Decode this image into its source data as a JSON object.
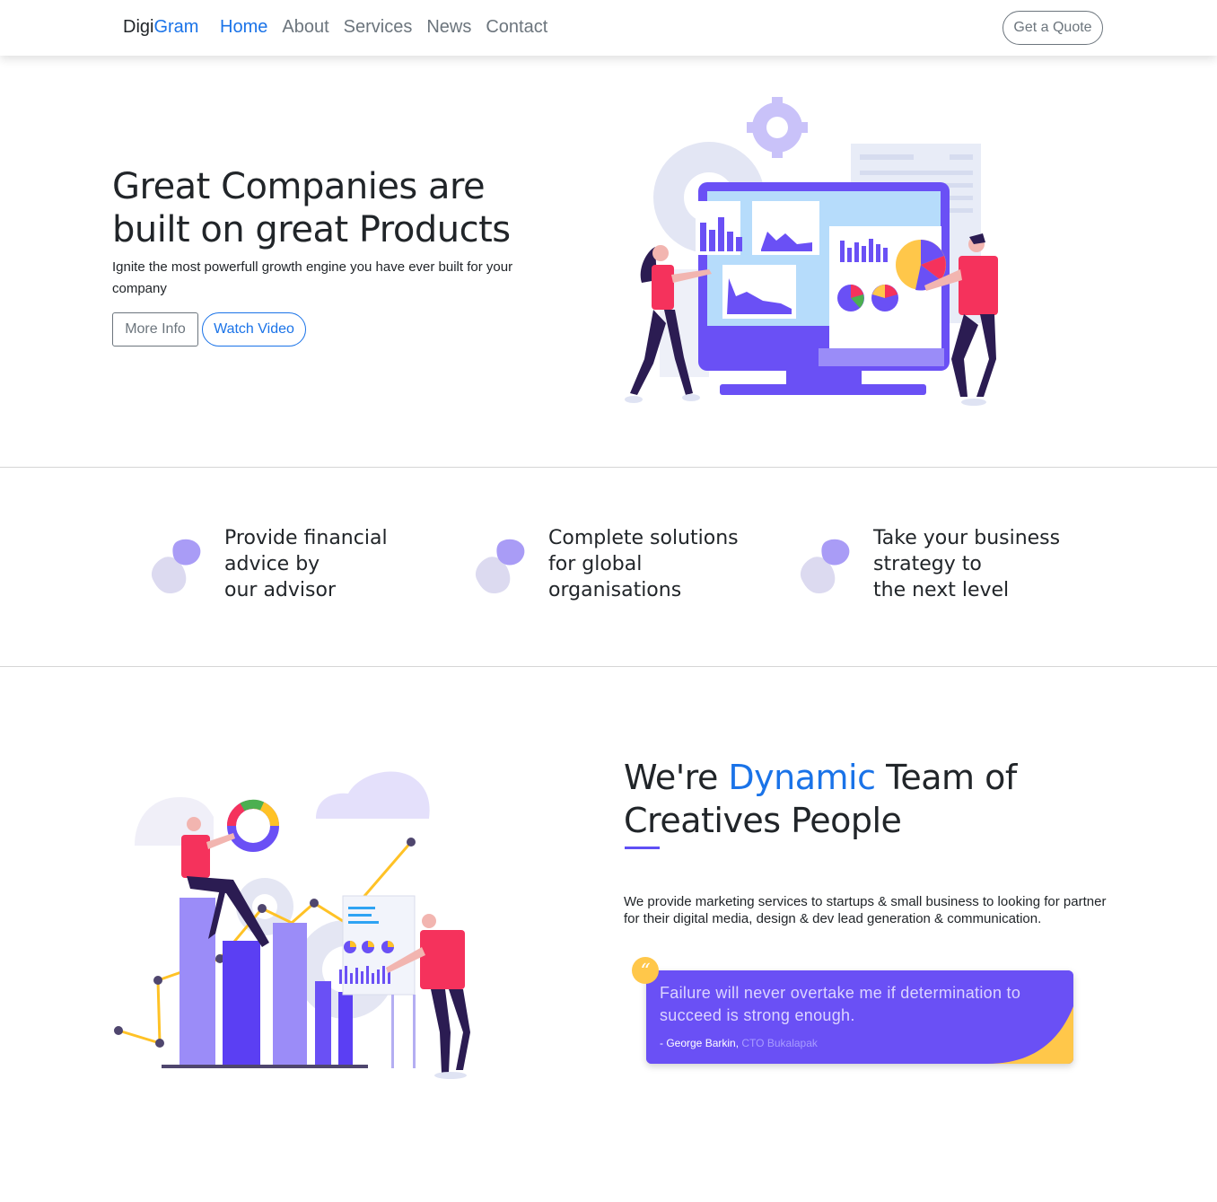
{
  "navbar": {
    "brand_part1": "Digi",
    "brand_part2": "Gram",
    "links": [
      {
        "label": "Home",
        "active": true
      },
      {
        "label": "About",
        "active": false
      },
      {
        "label": "Services",
        "active": false
      },
      {
        "label": "News",
        "active": false
      },
      {
        "label": "Contact",
        "active": false
      }
    ],
    "cta_label": "Get a Quote"
  },
  "hero": {
    "title_line1": "Great Companies are",
    "title_line2": "built on great Products",
    "subtitle": "Ignite the most powerfull growth engine you have ever built for your company",
    "more_info_label": "More Info",
    "watch_video_label": "Watch Video",
    "illustration": "analytics-dashboard-illustration"
  },
  "features": [
    {
      "line1": "Provide financial",
      "line2": "advice by",
      "line3": "our advisor",
      "icon": "blob-icon"
    },
    {
      "line1": "Complete solutions",
      "line2": "for global",
      "line3": "organisations",
      "icon": "blob-icon"
    },
    {
      "line1": "Take your business",
      "line2": "strategy to",
      "line3": "the next level",
      "icon": "blob-icon"
    }
  ],
  "team": {
    "title_part1": "We're ",
    "title_accent": "Dynamic",
    "title_part2": " Team of",
    "title_line2": "Creatives People",
    "description": "We provide marketing services to startups & small business to looking for partner for their digital media, design & dev lead generation & communication.",
    "illustration": "team-growth-chart-illustration",
    "quote": {
      "mark": "“",
      "text": "Failure will never overtake me if determination to succeed is strong enough.",
      "author": "- George Barkin,",
      "role": "CTO Bukalapak"
    }
  },
  "colors": {
    "accent_blue": "#1a73e8",
    "purple": "#6a50f5",
    "yellow": "#ffc74a",
    "pink": "#f5325c",
    "light_purple": "#a99cf6"
  }
}
